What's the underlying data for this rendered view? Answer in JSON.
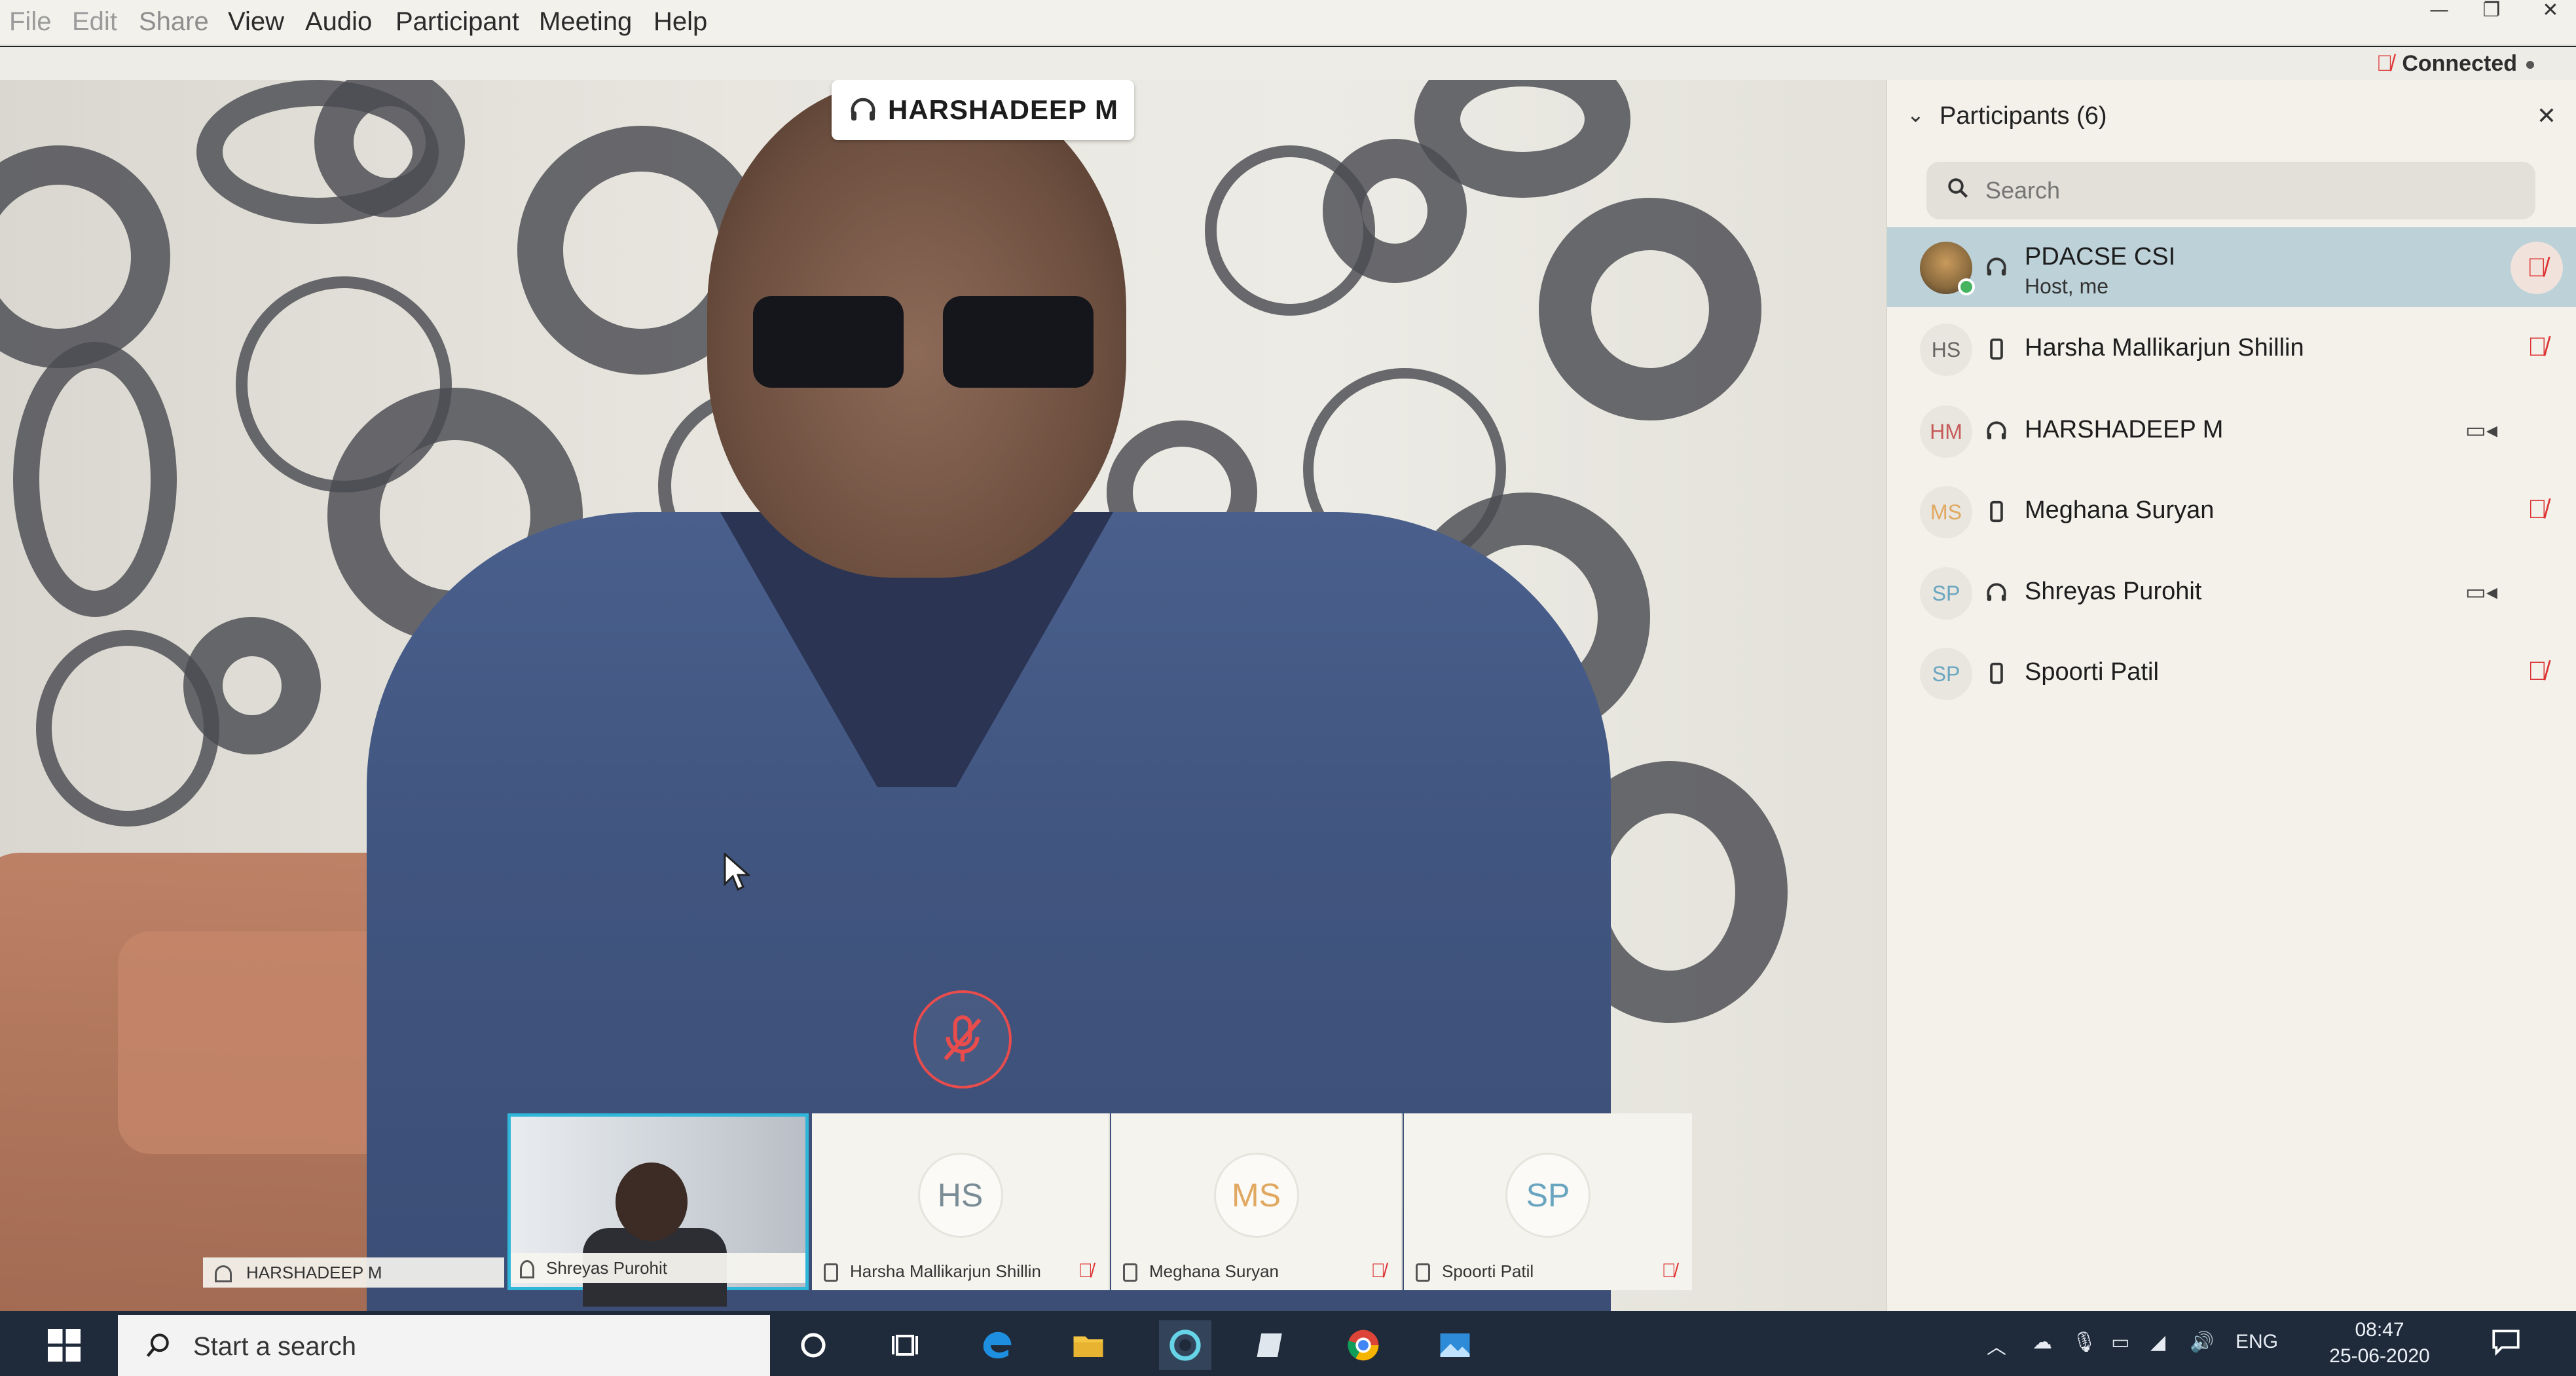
{
  "menu": {
    "items": [
      "File",
      "Edit",
      "Share",
      "View",
      "Audio",
      "Participant",
      "Meeting",
      "Help"
    ]
  },
  "window": {
    "minimize": "—",
    "restore": "❐",
    "close": "✕"
  },
  "status": {
    "connection": "Connected"
  },
  "stage": {
    "active_speaker": "HARSHADEEP M"
  },
  "thumbnails": {
    "speaker_caption": "HARSHADEEP M",
    "items": [
      {
        "initials": "",
        "name": "Shreyas Purohit",
        "muted": false
      },
      {
        "initials": "HS",
        "name": "Harsha Mallikarjun Shillin",
        "muted": true
      },
      {
        "initials": "MS",
        "name": "Meghana Suryan",
        "muted": true
      },
      {
        "initials": "SP",
        "name": "Spoorti Patil",
        "muted": true
      }
    ]
  },
  "participants": {
    "title": "Participants (6)",
    "search_placeholder": "Search",
    "list": [
      {
        "initials": "",
        "name": "PDACSE CSI",
        "sub": "Host, me",
        "device": "headset",
        "right": "mic-muted"
      },
      {
        "initials": "HS",
        "name": "Harsha Mallikarjun Shillin",
        "sub": "",
        "device": "phone",
        "right": "mic-muted"
      },
      {
        "initials": "HM",
        "name": "HARSHADEEP M",
        "sub": "",
        "device": "headset",
        "right": "camera"
      },
      {
        "initials": "MS",
        "name": "Meghana Suryan",
        "sub": "",
        "device": "phone",
        "right": "mic-muted"
      },
      {
        "initials": "SP",
        "name": "Shreyas Purohit",
        "sub": "",
        "device": "headset",
        "right": "camera"
      },
      {
        "initials": "SP",
        "name": "Spoorti Patil",
        "sub": "",
        "device": "phone",
        "right": "mic-muted"
      }
    ]
  },
  "taskbar": {
    "search_text": "Start a search",
    "language": "ENG",
    "time": "08:47",
    "date": "25-06-2020"
  },
  "colors": {
    "accent": "#30b6d8",
    "host_row": "#bcd1d8",
    "muted_red": "#dd3333",
    "taskbar": "#1f2b3b"
  }
}
